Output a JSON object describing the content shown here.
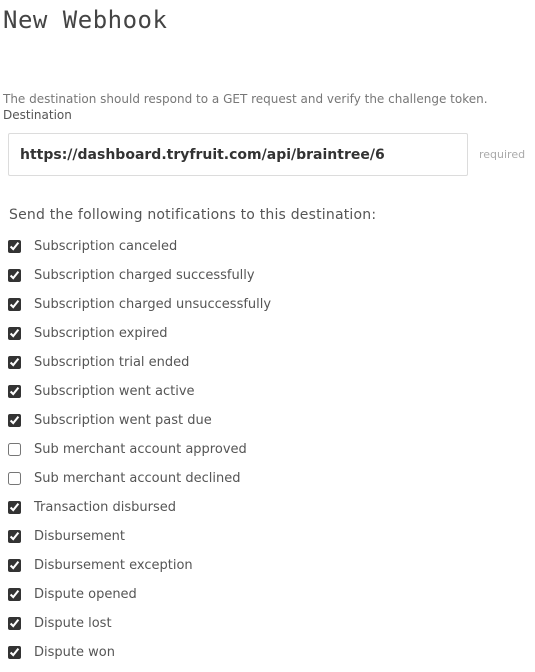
{
  "page": {
    "title": "New Webhook"
  },
  "destination": {
    "help_text": "The destination should respond to a GET request and verify the challenge token.",
    "label": "Destination",
    "value": "https://dashboard.tryfruit.com/api/braintree/6",
    "required_hint": "required"
  },
  "notifications": {
    "heading": "Send the following notifications to this destination:",
    "items": [
      {
        "label": "Subscription canceled",
        "checked": true
      },
      {
        "label": "Subscription charged successfully",
        "checked": true
      },
      {
        "label": "Subscription charged unsuccessfully",
        "checked": true
      },
      {
        "label": "Subscription expired",
        "checked": true
      },
      {
        "label": "Subscription trial ended",
        "checked": true
      },
      {
        "label": "Subscription went active",
        "checked": true
      },
      {
        "label": "Subscription went past due",
        "checked": true
      },
      {
        "label": "Sub merchant account approved",
        "checked": false
      },
      {
        "label": "Sub merchant account declined",
        "checked": false
      },
      {
        "label": "Transaction disbursed",
        "checked": true
      },
      {
        "label": "Disbursement",
        "checked": true
      },
      {
        "label": "Disbursement exception",
        "checked": true
      },
      {
        "label": "Dispute opened",
        "checked": true
      },
      {
        "label": "Dispute lost",
        "checked": true
      },
      {
        "label": "Dispute won",
        "checked": true
      }
    ]
  }
}
